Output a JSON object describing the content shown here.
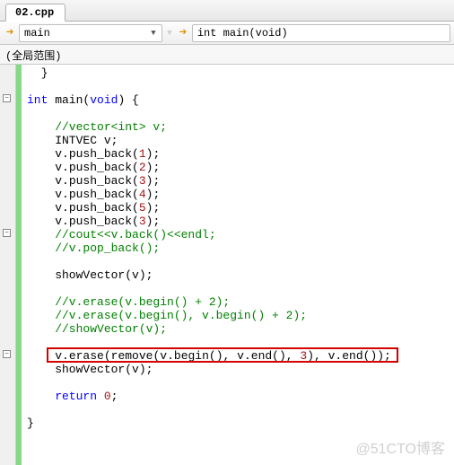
{
  "tab": {
    "title": "02.cpp"
  },
  "nav": {
    "scope_label": "main",
    "func_label": "int main(void)"
  },
  "subbar": {
    "text": "(全局范围)"
  },
  "code": {
    "l1": "  }",
    "l2": "",
    "l3a": "int",
    "l3b": " main(",
    "l3c": "void",
    "l3d": ") {",
    "l4": "",
    "l5": "    //vector<int> v;",
    "l6a": "    INTVEC v",
    "l6b": ";",
    "l7a": "    v",
    "l7b": ".",
    "l7c": "push_back",
    "l7p1": "(",
    "l7n": "1",
    "l7p2": ");",
    "l8n": "2",
    "l9n": "3",
    "l10n": "4",
    "l11n": "5",
    "l12n": "3",
    "l13": "    //cout<<v.back()<<endl;",
    "l14": "    //v.pop_back();",
    "l15": "",
    "l16a": "    showVector",
    "l16b": "(",
    "l16c": "v",
    "l16d": ");",
    "l17": "",
    "l18": "    //v.erase(v.begin() + 2);",
    "l19": "    //v.erase(v.begin(), v.begin() + 2);",
    "l20": "    //showVector(v);",
    "l21": "",
    "l22a": "    v",
    "l22b": ".",
    "l22c": "erase",
    "l22d": "(",
    "l22e": "remove",
    "l22f": "(",
    "l22g": "v",
    "l22h": ".",
    "l22i": "begin",
    "l22j": "(), ",
    "l22k": "v",
    "l22l": ".",
    "l22m": "end",
    "l22n": "(), ",
    "l22o": "3",
    "l22p": "), ",
    "l22q": "v",
    "l22r": ".",
    "l22s": "end",
    "l22t": "());",
    "l23a": "    showVector",
    "l23b": "(",
    "l23c": "v",
    "l23d": ");",
    "l24": "",
    "l25a": "    ",
    "l25b": "return",
    "l25c": " ",
    "l25d": "0",
    "l25e": ";",
    "l26": "",
    "l27": "}"
  },
  "watermark": "@51CTO博客"
}
